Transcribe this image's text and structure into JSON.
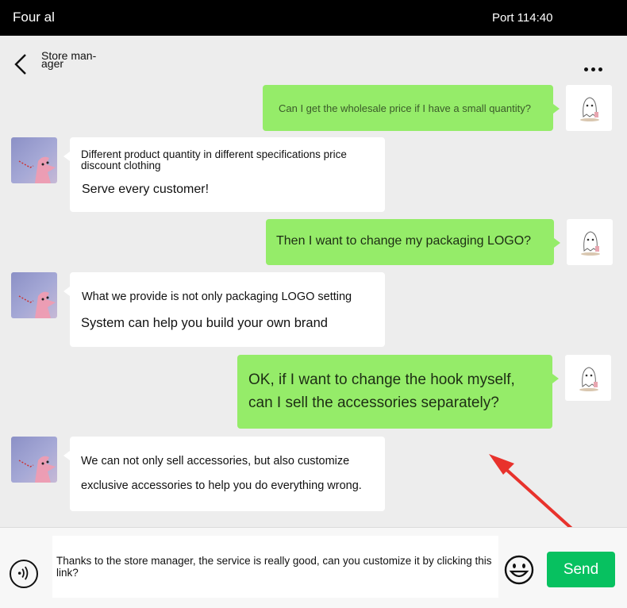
{
  "status_bar": {
    "carrier": "Four al",
    "time": "Port 114:40"
  },
  "header": {
    "title": "Store man-ager"
  },
  "messages": [
    {
      "sender": "me",
      "text": "Can I get the wholesale price if I have a small quantity?"
    },
    {
      "sender": "store",
      "line1": "Different product quantity in different specifications price discount clothing",
      "line2": "Serve every customer!"
    },
    {
      "sender": "me",
      "text": "Then I want to change my packaging LOGO?"
    },
    {
      "sender": "store",
      "line1": "What we provide is not only packaging LOGO setting",
      "line2": "System can help you build your own brand"
    },
    {
      "sender": "me",
      "line1": "OK, if I want to change the hook myself,",
      "line2": "can I sell the accessories separately?"
    },
    {
      "sender": "store",
      "line1": "We can not only sell accessories, but also customize",
      "line2": "exclusive accessories to help you do everything wrong."
    }
  ],
  "composer": {
    "input_value": "Thanks to the store manager, the service is really good, can you customize it by clicking this link?",
    "send_label": "Send"
  },
  "colors": {
    "me_bubble": "#95ec69",
    "send_button": "#07c160",
    "annotation_arrow": "#e8322c"
  },
  "icons": [
    "chevron-left-icon",
    "more-icon",
    "voice-icon",
    "emoji-icon"
  ]
}
